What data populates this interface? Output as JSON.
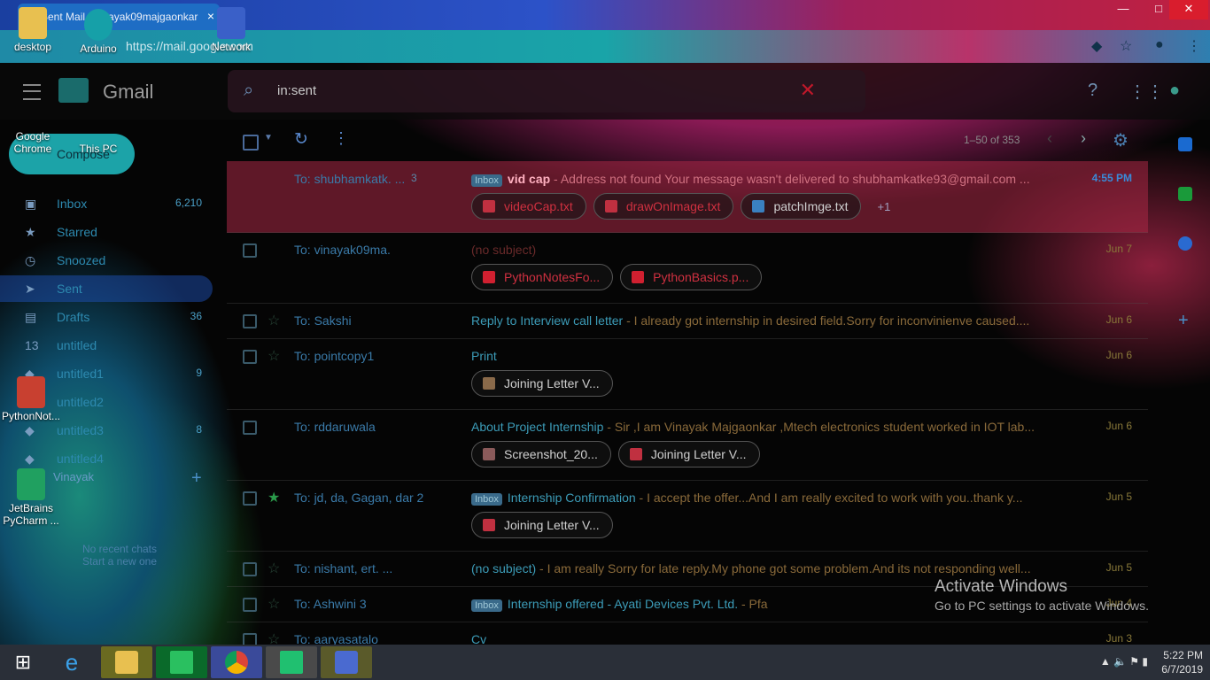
{
  "browser": {
    "tab_title": "Sent Mail - vinayak09majgaonkar",
    "tab_close": "×",
    "url": "https://mail.google.com",
    "window_min": "—",
    "window_max": "□",
    "window_close": "✕"
  },
  "desktop_icons": [
    {
      "label": "desktop"
    },
    {
      "label": "Arduino"
    },
    {
      "label": "Network"
    },
    {
      "label": "Google Chrome"
    },
    {
      "label": "This PC"
    },
    {
      "label": "PythonNot..."
    },
    {
      "label": "JetBrains PyCharm ..."
    }
  ],
  "gmail": {
    "wordmark": "Gmail",
    "search_query": "in:sent",
    "compose_label": "Compose",
    "nav": [
      {
        "label": "Inbox",
        "count": "6,210"
      },
      {
        "label": "Starred",
        "count": ""
      },
      {
        "label": "Snoozed",
        "count": ""
      },
      {
        "label": "Sent",
        "count": ""
      },
      {
        "label": "Drafts",
        "count": "36"
      },
      {
        "label": "untitled",
        "count": ""
      },
      {
        "label": "untitled1",
        "count": "9"
      },
      {
        "label": "untitled2",
        "count": ""
      },
      {
        "label": "untitled3",
        "count": "8"
      },
      {
        "label": "untitled4",
        "count": ""
      }
    ],
    "nav_badge": "13",
    "hangouts_user": "Vinayak",
    "no_chats_line1": "No recent chats",
    "no_chats_line2": "Start a new one",
    "pager_text": "1–50 of 353"
  },
  "emails": [
    {
      "to": "To: shubhamkatk. ...",
      "count": "3",
      "badge": "Inbox",
      "subject": "vid cap",
      "snippet": " - Address not found Your message wasn't delivered to shubhamkatke93@gmail.com ...",
      "date": "4:55 PM",
      "attachments": [
        "videoCap.txt",
        "drawOnImage.txt",
        "patchImge.txt"
      ],
      "more": "+1"
    },
    {
      "to": "To: vinayak09ma.",
      "count": "",
      "badge": "",
      "subject": "",
      "snippet": "(no subject)",
      "date": "Jun 7",
      "attachments": [
        "PythonNotesFo...",
        "PythonBasics.p..."
      ],
      "more": ""
    },
    {
      "to": "To: Sakshi",
      "count": "",
      "badge": "",
      "subject": "Reply to Interview call letter",
      "snippet": " - I already got internship in desired field.Sorry for inconvinienve caused....",
      "date": "Jun 6",
      "attachments": [],
      "more": ""
    },
    {
      "to": "To: pointcopy1",
      "count": "",
      "badge": "",
      "subject": "Print",
      "snippet": "",
      "date": "Jun 6",
      "attachments": [
        "Joining Letter V..."
      ],
      "more": ""
    },
    {
      "to": "To: rddaruwala",
      "count": "",
      "badge": "",
      "subject": "About Project Internship",
      "snippet": " - Sir ,I am Vinayak Majgaonkar ,Mtech electronics student worked in IOT lab...",
      "date": "Jun 6",
      "attachments": [
        "Screenshot_20...",
        "Joining Letter V..."
      ],
      "more": ""
    },
    {
      "to": "To: jd, da, Gagan, dar 2",
      "count": "",
      "badge": "Inbox",
      "subject": "Internship Confirmation",
      "snippet": " - I accept the offer...And I am really excited to work with you..thank y...",
      "date": "Jun 5",
      "attachments": [
        "Joining Letter V..."
      ],
      "more": ""
    },
    {
      "to": "To: nishant, ert. ...",
      "count": "",
      "badge": "",
      "subject": "(no subject)",
      "snippet": " - I am really Sorry for late reply.My phone got some problem.And its not responding well...",
      "date": "Jun 5",
      "attachments": [],
      "more": ""
    },
    {
      "to": "To: Ashwini 3",
      "count": "",
      "badge": "Inbox",
      "subject": "Internship offered - Ayati Devices Pvt. Ltd.",
      "snippet": " - Pfa",
      "date": "Jun 4",
      "attachments": [],
      "more": ""
    },
    {
      "to": "To: aaryasatalo",
      "count": "",
      "badge": "",
      "subject": "Cv",
      "snippet": "",
      "date": "Jun 3",
      "attachments": [],
      "more": ""
    }
  ],
  "watermark": {
    "title": "Activate Windows",
    "subtitle": "Go to PC settings to activate Windows."
  },
  "taskbar": {
    "time": "5:22 PM",
    "date": "6/7/2019"
  },
  "colors": {
    "accent": "#1ca3a8",
    "inbox_badge": "#3a6a8a",
    "close": "#d91d2d"
  }
}
